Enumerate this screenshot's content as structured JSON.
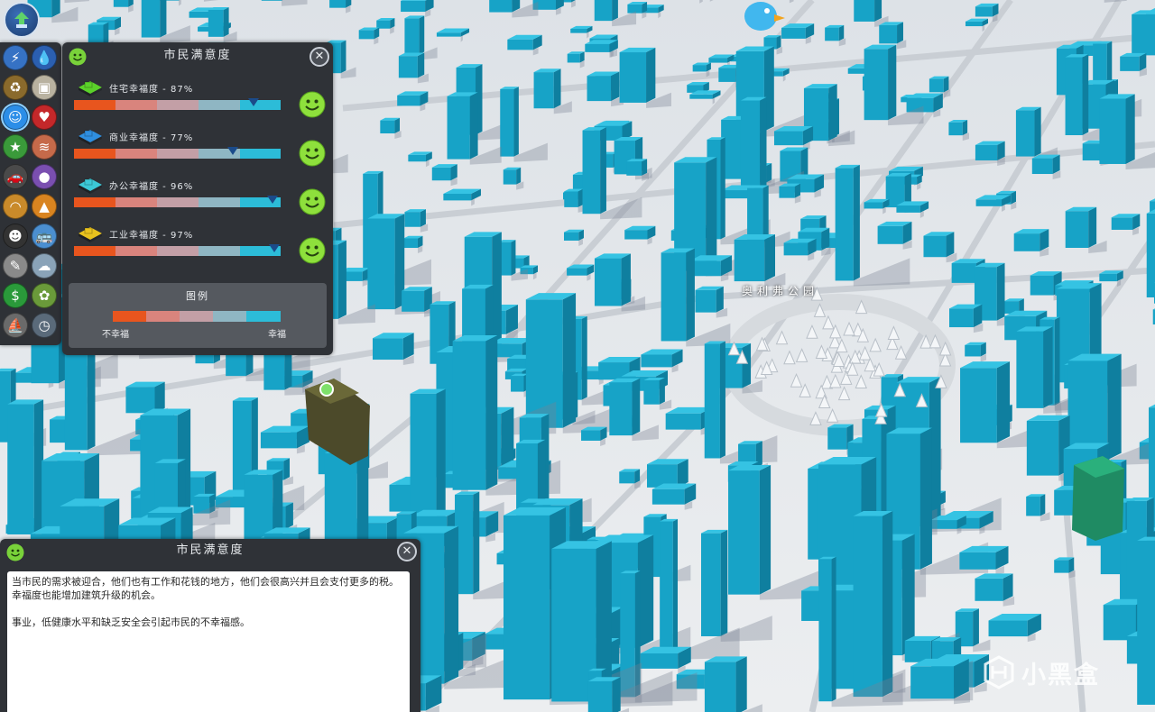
{
  "happiness_panel": {
    "title": "市民满意度",
    "rows": [
      {
        "label": "住宅幸福度 - 87%",
        "value": 0.87,
        "zone": "residential-icon",
        "icon_color": "#5bd12a"
      },
      {
        "label": "商业幸福度 - 77%",
        "value": 0.77,
        "zone": "commercial-icon",
        "icon_color": "#2f8fe0"
      },
      {
        "label": "办公幸福度 - 96%",
        "value": 0.96,
        "zone": "office-icon",
        "icon_color": "#3cc8d6"
      },
      {
        "label": "工业幸福度 - 97%",
        "value": 0.97,
        "zone": "industrial-icon",
        "icon_color": "#e8c21e"
      }
    ],
    "legend": {
      "title": "图例",
      "low": "不幸福",
      "high": "幸福"
    },
    "bar_colors": [
      "#e8551e",
      "#d9847d",
      "#c39fa6",
      "#8fb6c3",
      "#2cbcd8"
    ]
  },
  "info_panel": {
    "title": "市民满意度",
    "paragraph1": "当市民的需求被迎合，他们也有工作和花钱的地方，他们会很高兴并且会支付更多的税。幸福度也能增加建筑升级的机会。",
    "paragraph2": "事业，低健康水平和缺乏安全会引起市民的不幸福感。"
  },
  "scene": {
    "park_label": "奥利弗公园"
  },
  "watermark": {
    "text": "小黑盒"
  },
  "toolbar": {
    "items": [
      {
        "name": "electricity-icon",
        "glyph": "⚡",
        "color": "#3672c4"
      },
      {
        "name": "water-drop-icon",
        "glyph": "💧",
        "color": "#2b5fb0"
      },
      {
        "name": "garbage-icon",
        "glyph": "♻",
        "color": "#8a6a2c"
      },
      {
        "name": "building-level-icon",
        "glyph": "▣",
        "color": "#b9b2a0"
      },
      {
        "name": "happiness-icon",
        "glyph": "☺",
        "color": "#2c8ee8"
      },
      {
        "name": "health-heart-icon",
        "glyph": "♥",
        "color": "#c4282a"
      },
      {
        "name": "landmark-star-icon",
        "glyph": "★",
        "color": "#3a9a3a"
      },
      {
        "name": "wind-icon",
        "glyph": "≋",
        "color": "#c66a4a"
      },
      {
        "name": "traffic-car-icon",
        "glyph": "🚗",
        "color": "#4a4a4a"
      },
      {
        "name": "population-icon",
        "glyph": "●",
        "color": "#7a4fb0"
      },
      {
        "name": "noise-ear-icon",
        "glyph": "◠",
        "color": "#c98a2a"
      },
      {
        "name": "fire-safety-icon",
        "glyph": "▲",
        "color": "#d98420"
      },
      {
        "name": "crime-icon",
        "glyph": "☻",
        "color": "#333333"
      },
      {
        "name": "public-transport-icon",
        "glyph": "🚌",
        "color": "#4b8fd0"
      },
      {
        "name": "education-icon",
        "glyph": "✎",
        "color": "#8a8a8a"
      },
      {
        "name": "pollution-icon",
        "glyph": "☁",
        "color": "#8aa3b8"
      },
      {
        "name": "land-value-icon",
        "glyph": "$",
        "color": "#2a9a3a"
      },
      {
        "name": "natural-resources-icon",
        "glyph": "✿",
        "color": "#6a9a3a"
      },
      {
        "name": "tourism-icon",
        "glyph": "⛵",
        "color": "#6a6a6a"
      },
      {
        "name": "clock-icon",
        "glyph": "◷",
        "color": "#5a6a7a"
      }
    ]
  }
}
